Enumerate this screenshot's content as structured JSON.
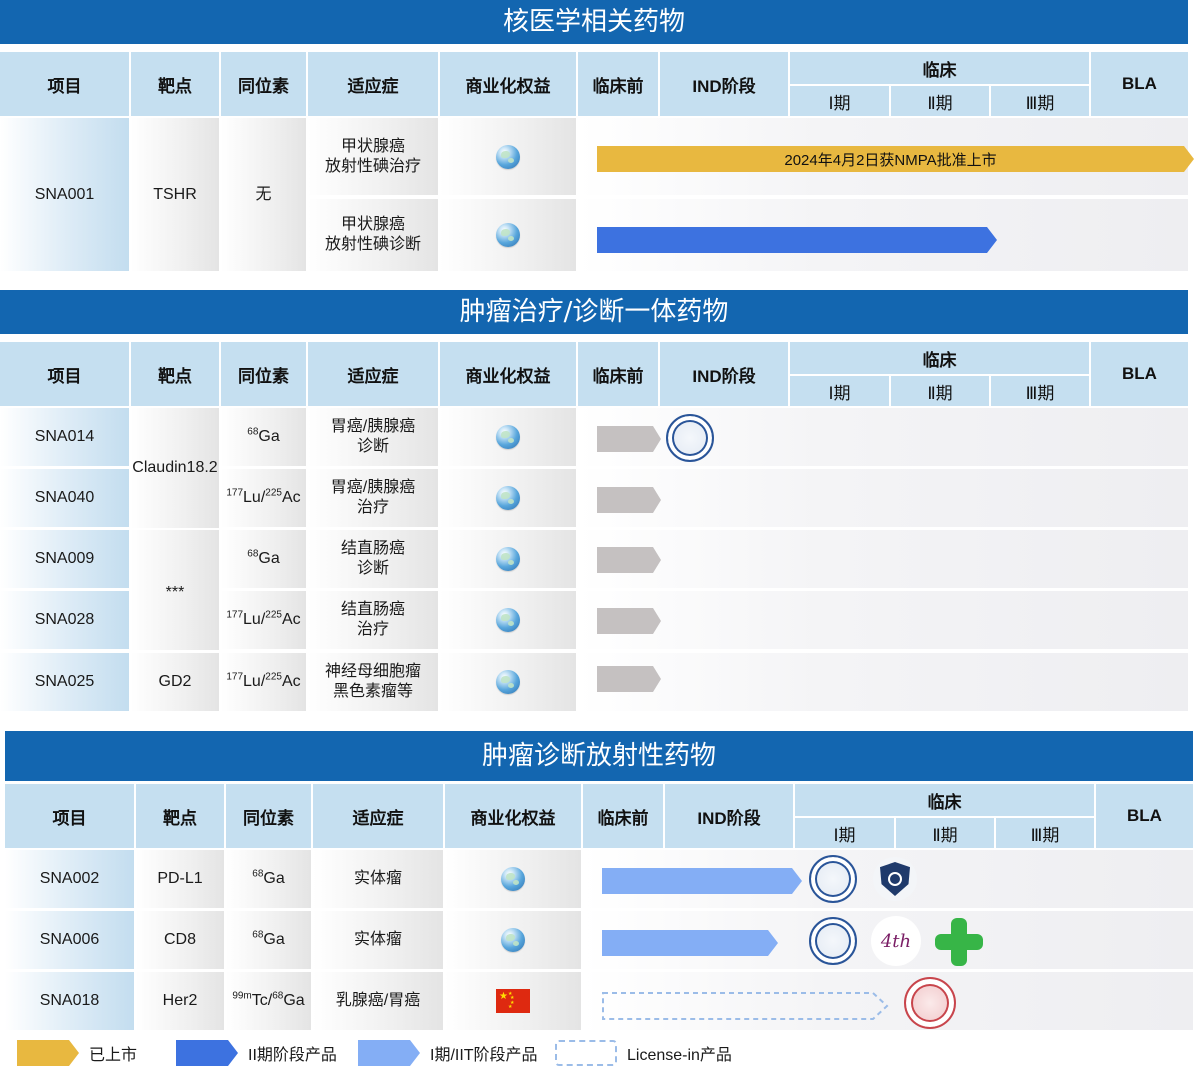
{
  "headers": {
    "project": "项目",
    "target": "靶点",
    "isotope": "同位素",
    "indication": "适应症",
    "rights": "商业化权益",
    "preclinical": "临床前",
    "ind": "IND阶段",
    "clinical": "临床",
    "phase1": "Ⅰ期",
    "phase2": "Ⅱ期",
    "phase3": "Ⅲ期",
    "bla": "BLA"
  },
  "sections": [
    {
      "title": "核医学相关药物"
    },
    {
      "title": "肿瘤治疗/诊断一体药物"
    },
    {
      "title": "肿瘤诊断放射性药物"
    }
  ],
  "sec1": {
    "project": "SNA001",
    "target": "TSHR",
    "isotope": "无",
    "rows": [
      {
        "indication_1": "甲状腺癌",
        "indication_2": "放射性碘治疗",
        "rights_icon": "globe-icon",
        "bar_label": "2024年4月2日获NMPA批准上市",
        "bar_status": "approved"
      },
      {
        "indication_1": "甲状腺癌",
        "indication_2": "放射性碘诊断",
        "rights_icon": "globe-icon",
        "bar_label": "",
        "bar_status": "phase2"
      }
    ]
  },
  "sec2": {
    "rows": [
      {
        "project": "SNA014",
        "isotope_sup": "68",
        "isotope_main": "Ga",
        "indication_1": "胃癌/胰腺癌",
        "indication_2": "诊断",
        "rights_icon": "globe-icon",
        "bar_status": "preclinical"
      },
      {
        "project": "SNA040",
        "isotope_sup1": "177",
        "isotope_main1": "Lu/",
        "isotope_sup2": "225",
        "isotope_main2": "Ac",
        "indication_1": "胃癌/胰腺癌",
        "indication_2": "治疗",
        "rights_icon": "globe-icon",
        "bar_status": "preclinical"
      },
      {
        "project": "SNA009",
        "isotope_sup": "68",
        "isotope_main": "Ga",
        "indication_1": "结直肠癌",
        "indication_2": "诊断",
        "rights_icon": "globe-icon",
        "bar_status": "preclinical"
      },
      {
        "project": "SNA028",
        "isotope_sup1": "177",
        "isotope_main1": "Lu/",
        "isotope_sup2": "225",
        "isotope_main2": "Ac",
        "indication_1": "结直肠癌",
        "indication_2": "治疗",
        "rights_icon": "globe-icon",
        "bar_status": "preclinical"
      },
      {
        "project": "SNA025",
        "target": "GD2",
        "isotope_sup1": "177",
        "isotope_main1": "Lu/",
        "isotope_sup2": "225",
        "isotope_main2": "Ac",
        "indication_1": "神经母细胞瘤",
        "indication_2": "黑色素瘤等",
        "rights_icon": "globe-icon",
        "bar_status": "preclinical"
      }
    ],
    "target_claudin": "Claudin18.2",
    "target_hidden": "***"
  },
  "sec3": {
    "rows": [
      {
        "project": "SNA002",
        "target": "PD-L1",
        "isotope_sup": "68",
        "isotope_main": "Ga",
        "indication": "实体瘤",
        "rights_icon": "globe-icon",
        "bar_status": "phase1"
      },
      {
        "project": "SNA006",
        "target": "CD8",
        "isotope_sup": "68",
        "isotope_main": "Ga",
        "indication": "实体瘤",
        "rights_icon": "globe-icon",
        "bar_status": "phase1"
      },
      {
        "project": "SNA018",
        "target": "Her2",
        "isotope_sup1": "99m",
        "isotope_main1": "Tc/",
        "isotope_sup2": "68",
        "isotope_main2": "Ga",
        "indication": "乳腺癌/胃癌",
        "rights_icon": "china-flag-icon",
        "bar_status": "license-in"
      }
    ]
  },
  "logo_text_4th": "4th",
  "legend": [
    {
      "label": "已上市",
      "color": "#e8b840"
    },
    {
      "label": "II期阶段产品",
      "color": "#3d72e0"
    },
    {
      "label": "I期/IIT阶段产品",
      "color": "#84aef5"
    },
    {
      "label": "License-in产品",
      "color": "#9bbce8"
    }
  ]
}
